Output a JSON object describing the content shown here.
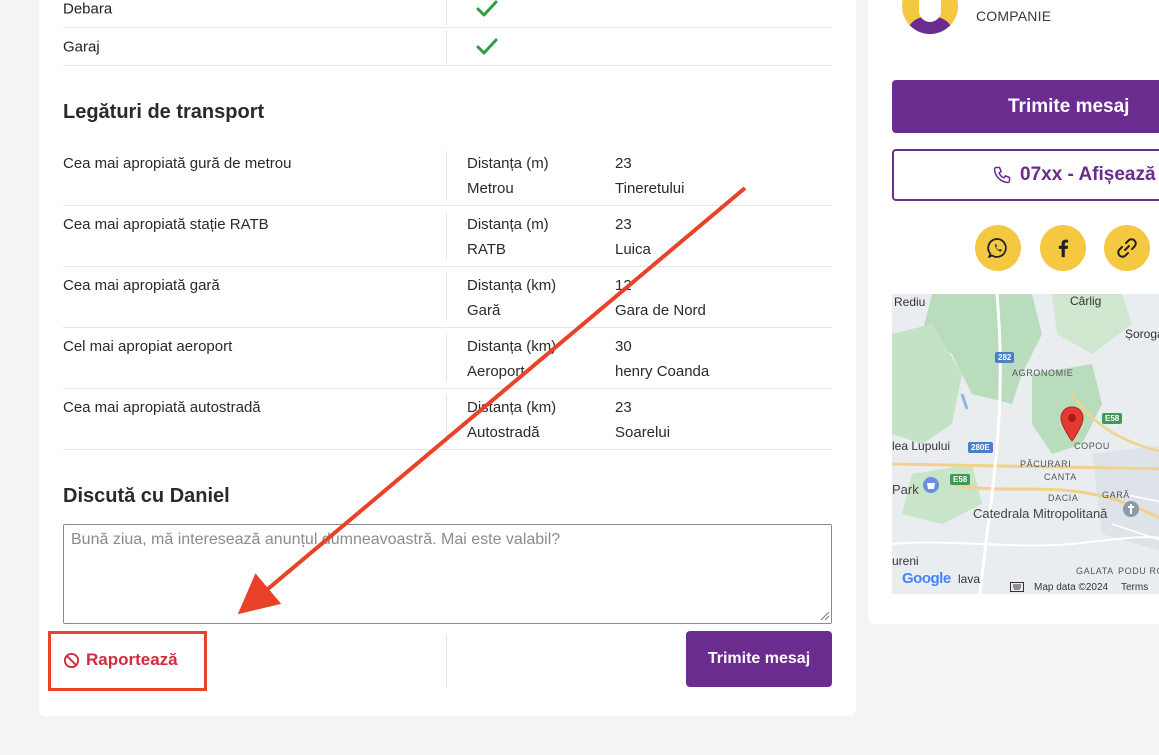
{
  "amenities": [
    {
      "label": "Debara",
      "value": "check-icon"
    },
    {
      "label": "Garaj",
      "value": "check-icon"
    }
  ],
  "transport": {
    "title": "Legături de transport",
    "rows": [
      {
        "name": "Cea mai apropiată gură de metrou",
        "k1": "Distanța (m)",
        "v1": "23",
        "k2": "Metrou",
        "v2": "Tineretului"
      },
      {
        "name": "Cea mai apropiată stație RATB",
        "k1": "Distanța (m)",
        "v1": "23",
        "k2": "RATB",
        "v2": "Luica"
      },
      {
        "name": "Cea mai apropiată gară",
        "k1": "Distanța (km)",
        "v1": "12",
        "k2": "Gară",
        "v2": "Gara de Nord"
      },
      {
        "name": "Cel mai apropiat aeroport",
        "k1": "Distanța (km)",
        "v1": "30",
        "k2": "Aeroport",
        "v2": "henry Coanda"
      },
      {
        "name": "Cea mai apropiată autostradă",
        "k1": "Distanța (km)",
        "v1": "23",
        "k2": "Autostradă",
        "v2": "Soarelui"
      }
    ]
  },
  "chat": {
    "title": "Discută cu Daniel",
    "placeholder": "Bună ziua, mă interesează anunțul dumneavoastră. Mai este valabil?",
    "send_label": "Trimite mesaj",
    "report_label": "Raportează"
  },
  "sidebar": {
    "company_tag": "COMPANIE",
    "send_label": "Trimite mesaj",
    "phone_label": "07xx - Afișează",
    "social": [
      "whatsapp-icon",
      "facebook-icon",
      "link-icon"
    ]
  },
  "map": {
    "labels": {
      "rediu": "Rediu",
      "carlig": "Cârlig",
      "sorogari": "Șorogari",
      "agronomie": "AGRONOMIE",
      "valea_lupului": "lea Lupului",
      "copou": "COPOU",
      "pacurari": "PĂCURARI",
      "canta": "CANTA",
      "dacia": "DACIA",
      "gara": "GARĂ",
      "catedrala": "Catedrala Mitropolitană",
      "park": "Park",
      "ureni": "ureni",
      "galata": "GALATA",
      "podu_ro": "PODU RO",
      "lava": "lava",
      "road_282": "282",
      "road_e58": "E58",
      "road_280e": "280E",
      "road_e58b": "E58"
    },
    "google": "Google",
    "map_data": "Map data ©2024",
    "terms": "Terms"
  },
  "colors": {
    "brand_purple": "#6a2c8e",
    "accent_yellow": "#f5c842",
    "report_red": "#d22b3f",
    "annotation_red": "#e8432a",
    "check_green": "#2e9e3e"
  }
}
